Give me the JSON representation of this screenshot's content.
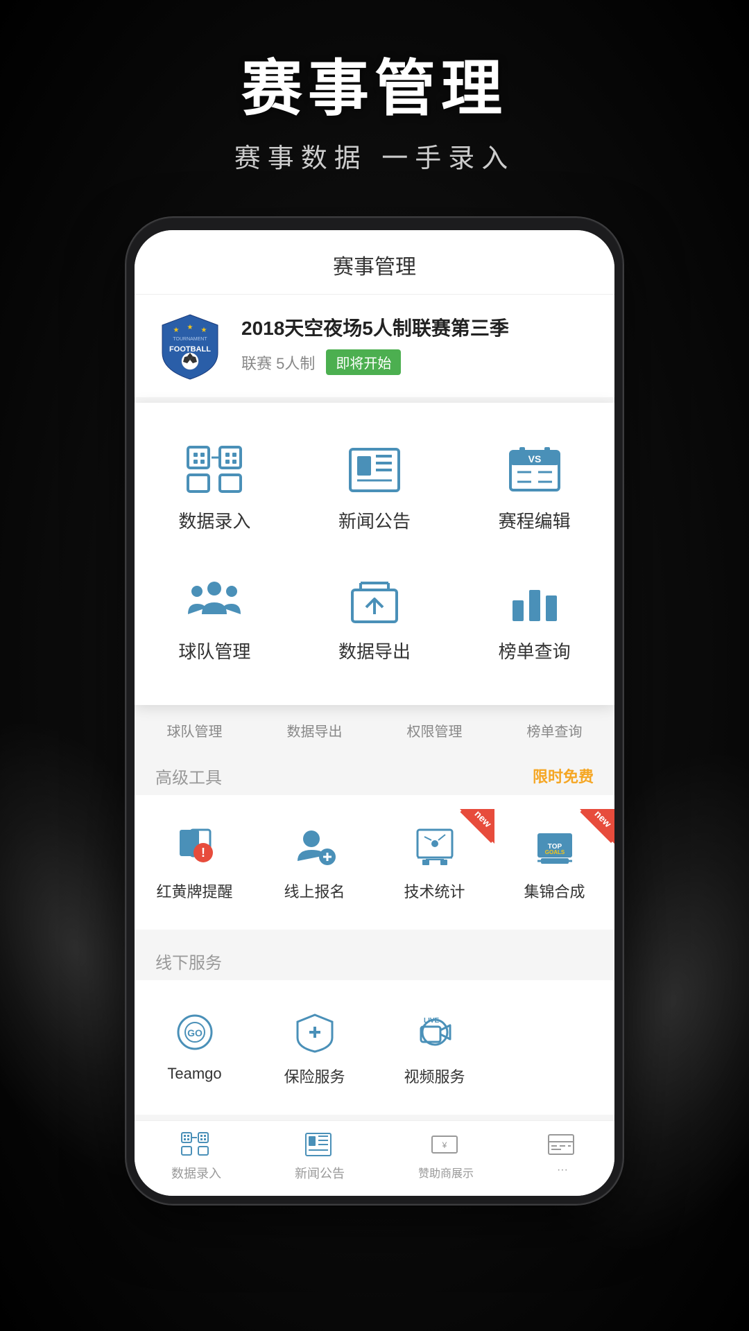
{
  "page": {
    "background": "#111"
  },
  "header": {
    "title": "赛事管理",
    "subtitle": "赛事数据 一手录入"
  },
  "app": {
    "title": "赛事管理",
    "tournament": {
      "name": "2018天空夜场5人制联赛第三季",
      "type": "联赛 5人制",
      "status": "即将开始"
    },
    "menu": {
      "items": [
        {
          "label": "数据录入",
          "icon": "data-entry"
        },
        {
          "label": "新闻公告",
          "icon": "news"
        },
        {
          "label": "赛程编辑",
          "icon": "schedule"
        },
        {
          "label": "球队管理",
          "icon": "team"
        },
        {
          "label": "数据导出",
          "icon": "export"
        },
        {
          "label": "榜单查询",
          "icon": "ranking"
        }
      ]
    },
    "bottom_quick_nav": {
      "items": [
        {
          "label": "球队管理"
        },
        {
          "label": "数据导出"
        },
        {
          "label": "权限管理"
        },
        {
          "label": "榜单查询"
        }
      ]
    },
    "advanced_tools": {
      "section_label": "高级工具",
      "badge": "限时免费",
      "items": [
        {
          "label": "红黄牌提醒",
          "icon": "card-reminder",
          "is_new": false
        },
        {
          "label": "线上报名",
          "icon": "online-signup",
          "is_new": false
        },
        {
          "label": "技术统计",
          "icon": "tech-stats",
          "is_new": true
        },
        {
          "label": "集锦合成",
          "icon": "highlight",
          "is_new": true
        }
      ]
    },
    "offline_services": {
      "section_label": "线下服务",
      "items": [
        {
          "label": "Teamgo",
          "icon": "teamgo"
        },
        {
          "label": "保险服务",
          "icon": "insurance"
        },
        {
          "label": "视频服务",
          "icon": "video"
        }
      ]
    },
    "bottom_tab": {
      "items": [
        {
          "label": "数据录入",
          "icon": "data-entry-tab"
        },
        {
          "label": "新闻公告",
          "icon": "news-tab"
        },
        {
          "label": "赞助商展示",
          "icon": "sponsor-tab"
        },
        {
          "label": "...",
          "icon": "more-tab"
        }
      ]
    }
  }
}
